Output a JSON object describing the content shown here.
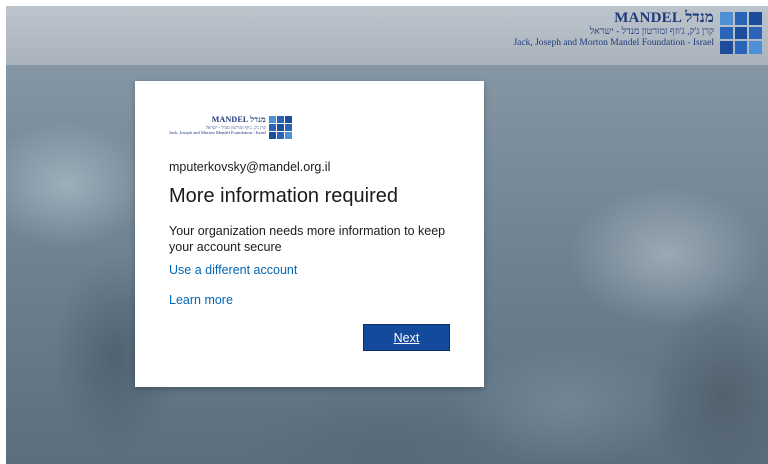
{
  "banner": {
    "logo_name": "MANDEL מנדל",
    "logo_hebrew": "קרן ג'ק, ג'וזף ומורטון מנדל - ישראל",
    "logo_english": "Jack, Joseph and Morton Mandel Foundation - Israel"
  },
  "card": {
    "logo_name": "MANDEL מנדל",
    "logo_hebrew": "קרן ג'ק, ג'וזף ומורטון מנדל - ישראל",
    "logo_english": "Jack, Joseph and Morton Mandel Foundation - Israel",
    "email": "mputerkovsky@mandel.org.il",
    "title": "More information required",
    "description": "Your organization needs more information to keep your account secure",
    "use_different_account": "Use a different account",
    "learn_more": "Learn more",
    "next_label": "Next"
  },
  "colors": {
    "link": "#0067b8",
    "primary_button": "#134a9b",
    "brand_blue": "#2a64b8"
  }
}
